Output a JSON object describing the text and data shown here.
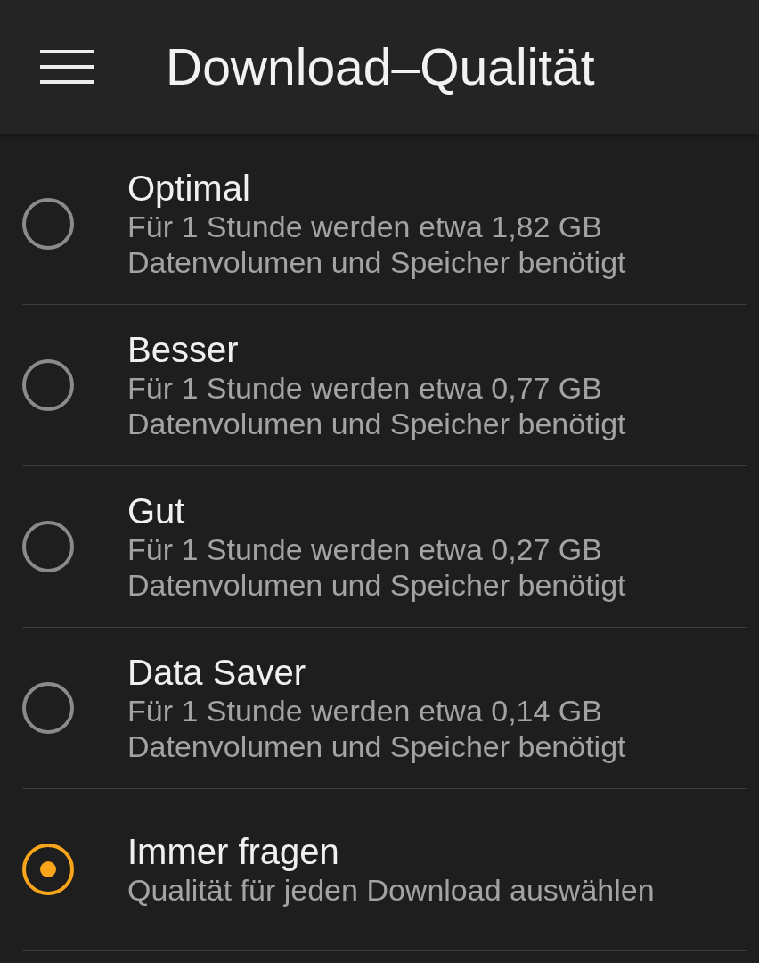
{
  "app_bar": {
    "title": "Download–Qualität"
  },
  "options": [
    {
      "title": "Optimal",
      "description": "Für 1 Stunde werden etwa 1,82 GB Datenvolumen und Speicher benötigt",
      "selected": false
    },
    {
      "title": "Besser",
      "description": "Für 1 Stunde werden etwa 0,77 GB Datenvolumen und Speicher benötigt",
      "selected": false
    },
    {
      "title": "Gut",
      "description": "Für 1 Stunde werden etwa 0,27 GB Datenvolumen und Speicher benötigt",
      "selected": false
    },
    {
      "title": "Data Saver",
      "description": "Für 1 Stunde werden etwa 0,14 GB Datenvolumen und Speicher benötigt",
      "selected": false
    },
    {
      "title": "Immer fragen",
      "description": "Qualität für jeden Download auswählen",
      "selected": true
    }
  ]
}
